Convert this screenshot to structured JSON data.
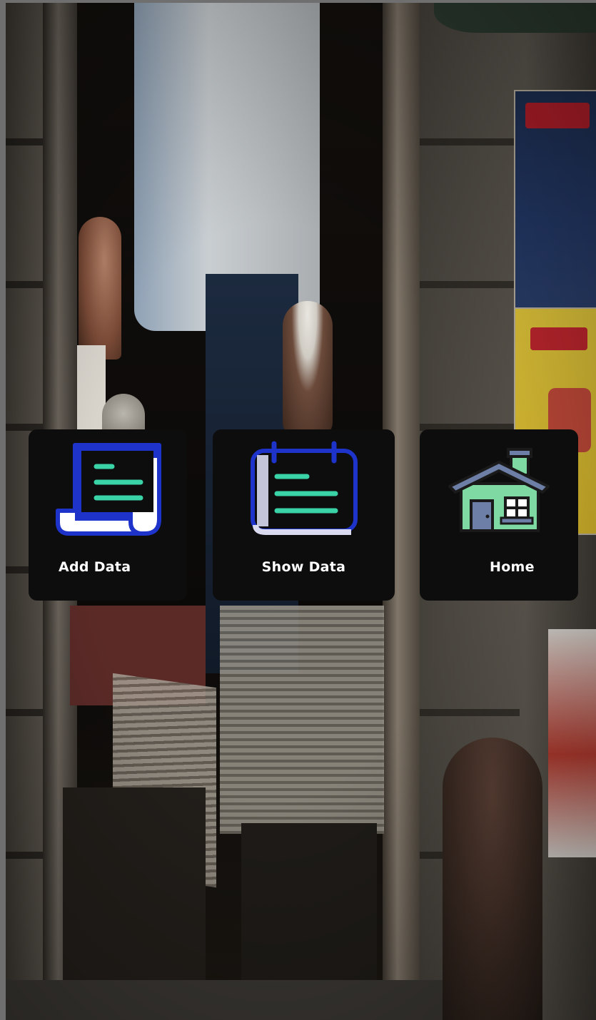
{
  "menu": {
    "items": [
      {
        "label": "Add Data",
        "icon": "add-document-icon"
      },
      {
        "label": "Show Data",
        "icon": "calendar-list-icon"
      },
      {
        "label": "Home",
        "icon": "home-icon"
      }
    ]
  },
  "colors": {
    "card_background": "#0d0d0d",
    "card_text": "#ffffff",
    "icon_blue": "#1d33c9",
    "icon_green": "#3ad3a8",
    "house_roof": "#6d7fa6",
    "house_wall": "#7ed9a3"
  }
}
